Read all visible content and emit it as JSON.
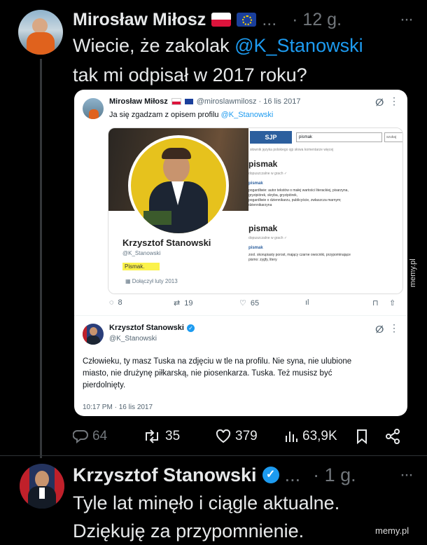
{
  "tweet1": {
    "author": "Mirosław Miłosz",
    "ellipsis": "...",
    "time": "· 12 g.",
    "text_before": "Wiecie, że zakolak ",
    "mention": "@K_Stanowski",
    "text_line2": "tak mi odpisał w 2017 roku?"
  },
  "screenshot": {
    "quoted": {
      "author": "Mirosław Miłosz",
      "handle": "@miroslawmilosz · 16 lis 2017",
      "text_before": "Ja się zgadzam z opisem profilu ",
      "mention": "@K_Stanowski",
      "profile_name": "Krzysztof Stanowski",
      "profile_handle": "@K_Stanowski",
      "profile_bio": "Pismak.",
      "profile_joined": "Dołączył luty 2013",
      "sjp_logo": "SJP",
      "sjp_search": "pismak",
      "sjp_btn": "szukaj",
      "sjp_nav": "słownik języka polskiego sjp   słowa   komentarze   więcej",
      "sjp_head1": "pismak",
      "sjp_sub1": "dopuszczalne w grach ✓",
      "sjp_link1": "pismak",
      "sjp_def1a": "pogardliwie: autor tekstów o małej wartości literackiej, pisarzyna,",
      "sjp_def1b": "gryzipiórek, skryba, gryzipiórek,",
      "sjp_def1c": "pogardliwie o dziennikarzu, publicyście, zwłaszcza marnym;",
      "sjp_def1d": "dziennikarzyna",
      "sjp_head2": "pismak",
      "sjp_sub2": "dopuszczalne w grach ✓",
      "sjp_link2": "pismak",
      "sjp_def2a": "zool. skorupiasty porost, mający czarne owocniki, przypominające",
      "sjp_def2b": "pismo: zygfy, litery",
      "replies": "8",
      "retweets": "19",
      "likes": "65"
    },
    "reply": {
      "author": "Krzysztof Stanowski",
      "handle": "@K_Stanowski",
      "text": "Człowieku, ty masz Tuska na zdjęciu w tle na profilu. Nie syna, nie ulubione miasto, nie drużynę piłkarską, nie piosenkarza. Tuska. Też musisz być pierdolnięty.",
      "timestamp": "10:17 PM · 16 lis 2017"
    }
  },
  "tweet1_actions": {
    "replies": "64",
    "retweets": "35",
    "likes": "379",
    "views": "63,9K"
  },
  "tweet2": {
    "author": "Krzysztof Stanowski",
    "ellipsis": "...",
    "time": "· 1 g.",
    "line1": "Tyle lat minęło i ciągle aktualne.",
    "line2": "Dziękuję za przypomnienie."
  },
  "watermark": "memy.pl",
  "watermark_side": "memy.pl",
  "colors": {
    "accent": "#1d9bf0",
    "bg": "#000000",
    "text": "#e7e9ea",
    "muted": "#71767b"
  }
}
